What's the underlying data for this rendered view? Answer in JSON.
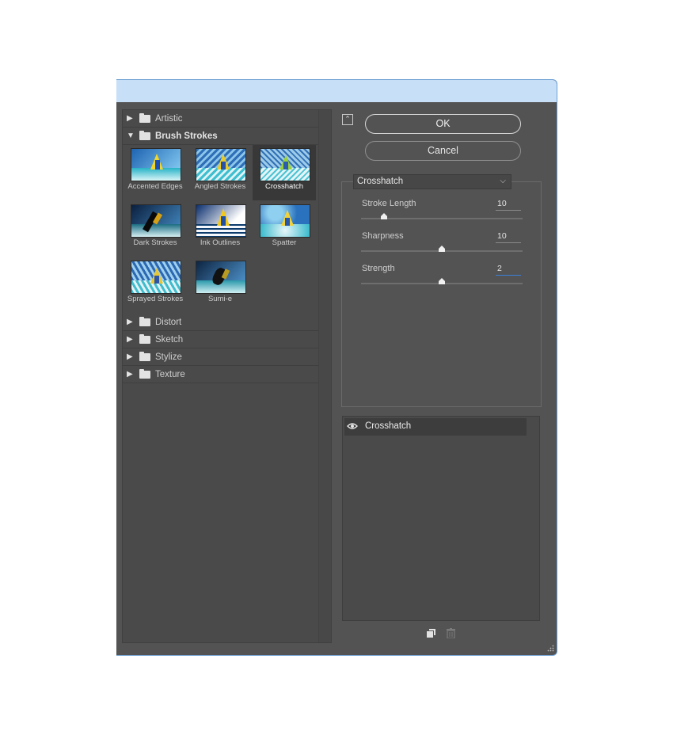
{
  "gallery": {
    "categories": {
      "artistic": "Artistic",
      "brush_strokes": "Brush Strokes",
      "distort": "Distort",
      "sketch": "Sketch",
      "stylize": "Stylize",
      "texture": "Texture"
    },
    "thumbnails": [
      {
        "label": "Accented Edges"
      },
      {
        "label": "Angled Strokes"
      },
      {
        "label": "Crosshatch",
        "selected": true
      },
      {
        "label": "Dark Strokes"
      },
      {
        "label": "Ink Outlines"
      },
      {
        "label": "Spatter"
      },
      {
        "label": "Sprayed Strokes"
      },
      {
        "label": "Sumi-e"
      }
    ]
  },
  "buttons": {
    "ok": "OK",
    "cancel": "Cancel"
  },
  "filter_select": {
    "value": "Crosshatch"
  },
  "params": {
    "stroke_length": {
      "label": "Stroke Length",
      "value": "10",
      "level": 0.14
    },
    "sharpness": {
      "label": "Sharpness",
      "value": "10",
      "level": 0.5
    },
    "strength": {
      "label": "Strength",
      "value": "2",
      "level": 0.5
    }
  },
  "layers": {
    "items": [
      {
        "name": "Crosshatch",
        "visible": true
      }
    ]
  },
  "colors": {
    "panel": "#535353",
    "titlebar": "#c7e0f8",
    "selected_thumb": "#383838",
    "focus_underline": "#3b7fd8"
  },
  "icons": {
    "expand": "triangle-right",
    "collapse": "triangle-down",
    "visibility": "eye-icon",
    "new_layer": "new-effect-layer-icon",
    "delete_layer": "trash-icon"
  }
}
